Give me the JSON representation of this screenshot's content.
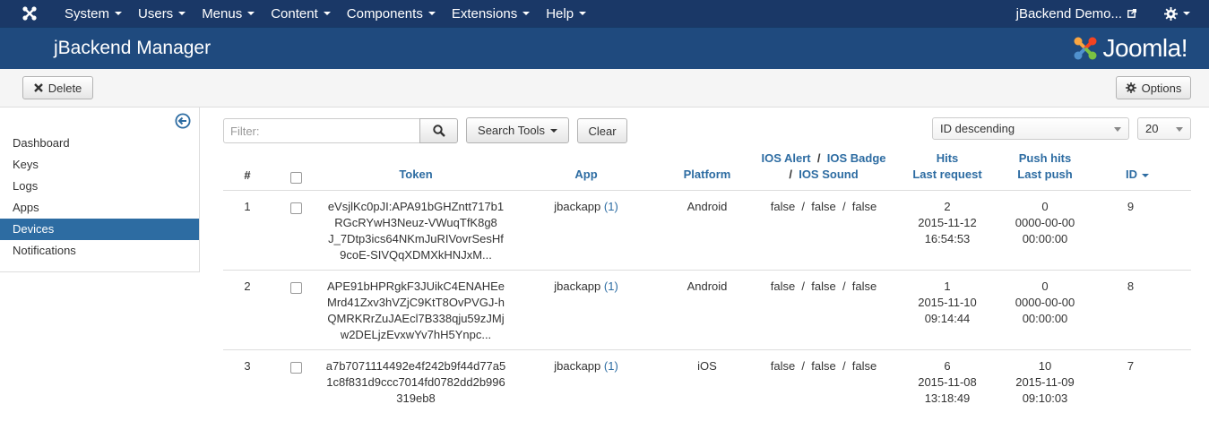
{
  "topnav": {
    "menus": [
      "System",
      "Users",
      "Menus",
      "Content",
      "Components",
      "Extensions",
      "Help"
    ],
    "site_link": "jBackend Demo..."
  },
  "header": {
    "title": "jBackend Manager",
    "brand": "Joomla!"
  },
  "toolbar": {
    "delete_label": "Delete",
    "options_label": "Options"
  },
  "sidebar": {
    "items": [
      {
        "label": "Dashboard",
        "active": false
      },
      {
        "label": "Keys",
        "active": false
      },
      {
        "label": "Logs",
        "active": false
      },
      {
        "label": "Apps",
        "active": false
      },
      {
        "label": "Devices",
        "active": true
      },
      {
        "label": "Notifications",
        "active": false
      }
    ]
  },
  "filters": {
    "placeholder": "Filter:",
    "search_tools_label": "Search Tools",
    "clear_label": "Clear",
    "sort_value": "ID descending",
    "limit_value": "20"
  },
  "table": {
    "headers": {
      "num": "#",
      "token": "Token",
      "app": "App",
      "platform": "Platform",
      "ios_alert": "IOS Alert",
      "ios_badge": "IOS Badge",
      "ios_sound": "IOS Sound",
      "hits": "Hits",
      "last_request": "Last request",
      "push_hits": "Push hits",
      "last_push": "Last push",
      "id": "ID",
      "sep": "/"
    },
    "rows": [
      {
        "num": "1",
        "token": [
          "eVsjlKc0pJI:APA91bGHZntt717b1",
          "RGcRYwH3Neuz-VWuqTfK8g8",
          "J_7Dtp3ics64NKmJuRIVovrSesHf",
          "9coE-SIVQqXDMXkHNJxM..."
        ],
        "app": "jbackapp",
        "app_count": "(1)",
        "platform": "Android",
        "flags": "false  /  false  /  false",
        "hits": [
          "2",
          "2015-11-12",
          "16:54:53"
        ],
        "push": [
          "0",
          "0000-00-00",
          "00:00:00"
        ],
        "id": "9"
      },
      {
        "num": "2",
        "token": [
          "APE91bHPRgkF3JUikC4ENAHEe",
          "Mrd41Zxv3hVZjC9KtT8OvPVGJ-h",
          "QMRKRrZuJAEcl7B338qju59zJMj",
          "w2DELjzEvxwYv7hH5Ynpc..."
        ],
        "app": "jbackapp",
        "app_count": "(1)",
        "platform": "Android",
        "flags": "false  /  false  /  false",
        "hits": [
          "1",
          "2015-11-10",
          "09:14:44"
        ],
        "push": [
          "0",
          "0000-00-00",
          "00:00:00"
        ],
        "id": "8"
      },
      {
        "num": "3",
        "token": [
          "a7b7071114492e4f242b9f44d77a5",
          "1c8f831d9ccc7014fd0782dd2b996",
          "319eb8"
        ],
        "app": "jbackapp",
        "app_count": "(1)",
        "platform": "iOS",
        "flags": "false  /  false  /  false",
        "hits": [
          "6",
          "2015-11-08",
          "13:18:49"
        ],
        "push": [
          "10",
          "2015-11-09",
          "09:10:03"
        ],
        "id": "7"
      }
    ]
  }
}
